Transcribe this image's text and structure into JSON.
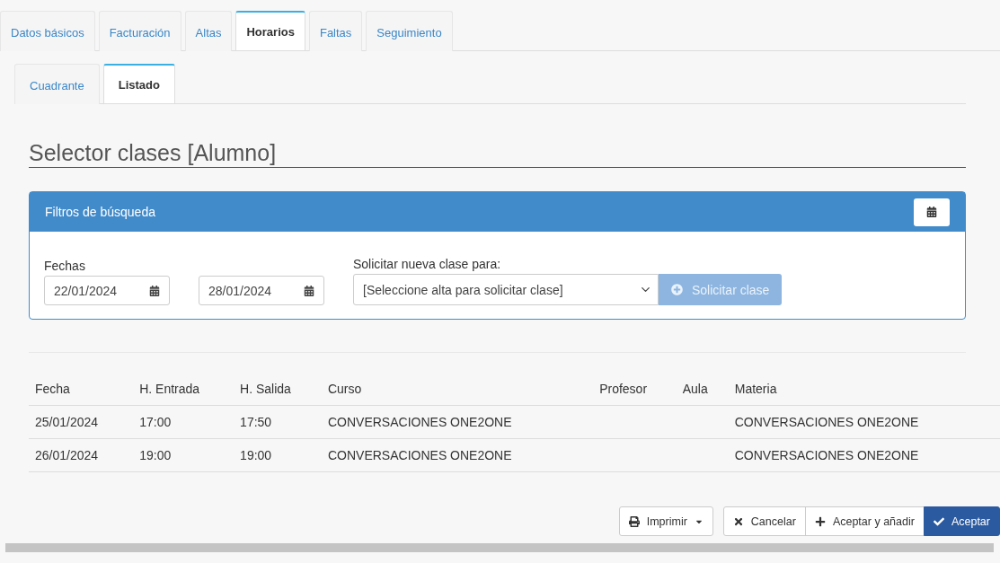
{
  "tabs": [
    {
      "label": "Datos básicos",
      "selected": false
    },
    {
      "label": "Facturación",
      "selected": false
    },
    {
      "label": "Altas",
      "selected": false
    },
    {
      "label": "Horarios",
      "selected": true
    },
    {
      "label": "Faltas",
      "selected": false
    },
    {
      "label": "Seguimiento",
      "selected": false
    }
  ],
  "subtabs": [
    {
      "label": "Cuadrante",
      "selected": false
    },
    {
      "label": "Listado",
      "selected": true
    }
  ],
  "title": "Selector clases [Alumno]",
  "filters": {
    "heading": "Filtros de búsqueda",
    "dates_label": "Fechas",
    "date_from": "22/01/2024",
    "date_to": "28/01/2024",
    "request_label": "Solicitar nueva clase para:",
    "request_select": "[Seleccione alta para solicitar clase]",
    "request_button": {
      "label": "Solicitar clase",
      "disabled": true
    }
  },
  "table": {
    "columns": [
      "Fecha",
      "H. Entrada",
      "H. Salida",
      "Curso",
      "Profesor",
      "Aula",
      "Materia"
    ],
    "rows": [
      [
        "25/01/2024",
        "17:00",
        "17:50",
        "CONVERSACIONES ONE2ONE",
        "",
        "",
        "CONVERSACIONES ONE2ONE"
      ],
      [
        "26/01/2024",
        "19:00",
        "19:00",
        "CONVERSACIONES ONE2ONE",
        "",
        "",
        "CONVERSACIONES ONE2ONE"
      ]
    ]
  },
  "buttons": [
    {
      "kind": "print",
      "label": "Imprimir"
    },
    {
      "kind": "cancel",
      "label": "Cancelar"
    },
    {
      "kind": "add",
      "label": "Aceptar y añadir"
    },
    {
      "kind": "accept",
      "label": "Aceptar"
    }
  ]
}
